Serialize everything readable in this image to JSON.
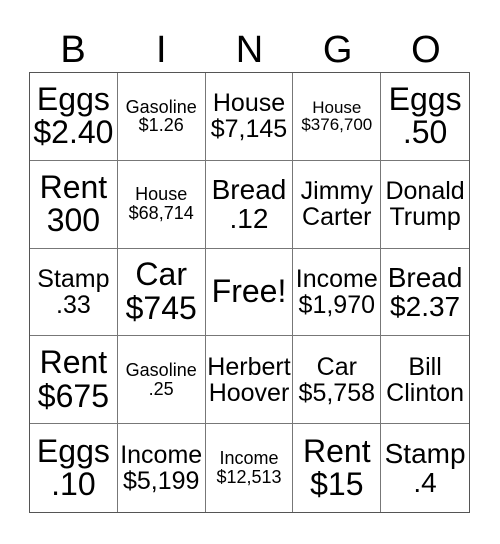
{
  "header": [
    "B",
    "I",
    "N",
    "G",
    "O"
  ],
  "cells": [
    {
      "line1": "Eggs",
      "line2": "$2.40",
      "size": "xl"
    },
    {
      "line1": "Gasoline",
      "line2": "$1.26",
      "size": "sm"
    },
    {
      "line1": "House",
      "line2": "$7,145",
      "size": "md"
    },
    {
      "line1": "House",
      "line2": "$376,700",
      "size": "xs"
    },
    {
      "line1": "Eggs",
      "line2": ".50",
      "size": "xl"
    },
    {
      "line1": "Rent",
      "line2": "300",
      "size": "xl"
    },
    {
      "line1": "House",
      "line2": "$68,714",
      "size": "sm"
    },
    {
      "line1": "Bread",
      "line2": ".12",
      "size": "lg"
    },
    {
      "line1": "Jimmy",
      "line2": "Carter",
      "size": "md"
    },
    {
      "line1": "Donald",
      "line2": "Trump",
      "size": "md"
    },
    {
      "line1": "Stamp",
      "line2": ".33",
      "size": "md"
    },
    {
      "line1": "Car",
      "line2": "$745",
      "size": "xl"
    },
    {
      "line1": "Free!",
      "line2": "",
      "size": "xl"
    },
    {
      "line1": "Income",
      "line2": "$1,970",
      "size": "md"
    },
    {
      "line1": "Bread",
      "line2": "$2.37",
      "size": "lg"
    },
    {
      "line1": "Rent",
      "line2": "$675",
      "size": "xl"
    },
    {
      "line1": "Gasoline",
      "line2": ".25",
      "size": "sm"
    },
    {
      "line1": "Herbert",
      "line2": "Hoover",
      "size": "md"
    },
    {
      "line1": "Car",
      "line2": "$5,758",
      "size": "md"
    },
    {
      "line1": "Bill",
      "line2": "Clinton",
      "size": "md"
    },
    {
      "line1": "Eggs",
      "line2": ".10",
      "size": "xl"
    },
    {
      "line1": "Income",
      "line2": "$5,199",
      "size": "md"
    },
    {
      "line1": "Income",
      "line2": "$12,513",
      "size": "sm"
    },
    {
      "line1": "Rent",
      "line2": "$15",
      "size": "xl"
    },
    {
      "line1": "Stamp",
      "line2": ".4",
      "size": "lg"
    }
  ]
}
